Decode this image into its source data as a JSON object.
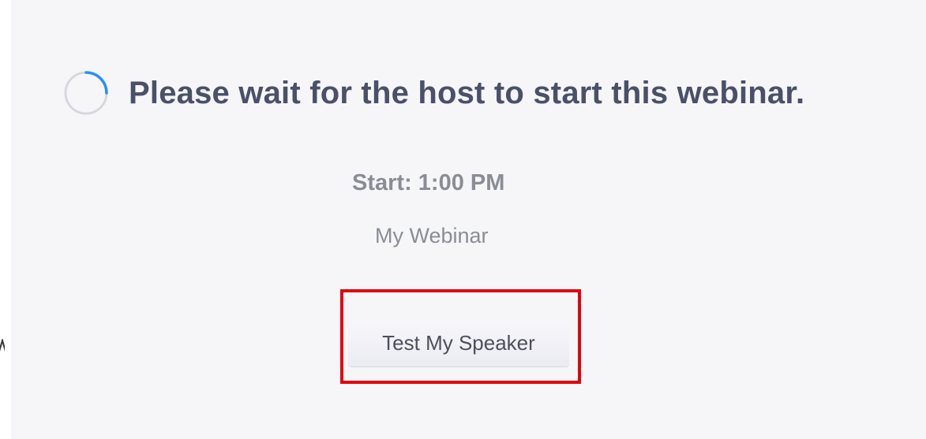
{
  "waiting_room": {
    "spinner_icon": "loading-spinner-icon",
    "title": "Please wait for the host to start this webinar.",
    "start_time": "Start: 1:00 PM",
    "webinar_name": "My Webinar",
    "test_speaker_label": "Test My Speaker"
  },
  "colors": {
    "background": "#f6f6f9",
    "title_text": "#4a5068",
    "secondary_text": "#8a8c96",
    "spinner_track": "#d6d8df",
    "spinner_arc": "#2d8cff",
    "highlight": "#e5000d"
  }
}
